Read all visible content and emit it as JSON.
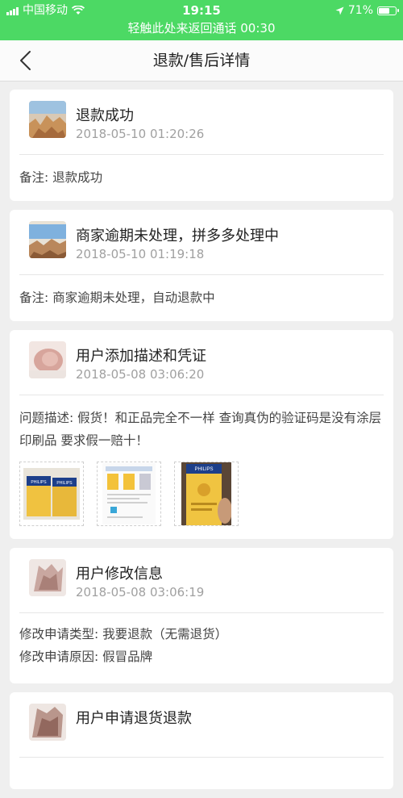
{
  "status_bar": {
    "carrier": "中国移动",
    "time": "19:15",
    "battery": "71%",
    "battery_level": 0.71,
    "call_banner": "轻触此处来返回通话 00:30"
  },
  "nav": {
    "title": "退款/售后详情",
    "back_icon": "chevron-left-icon"
  },
  "entries": [
    {
      "title": "退款成功",
      "time": "2018-05-10 01:20:26",
      "lines": [
        "备注: 退款成功"
      ]
    },
    {
      "title": "商家逾期未处理，拼多多处理中",
      "time": "2018-05-10 01:19:18",
      "lines": [
        "备注: 商家逾期未处理，自动退款中"
      ]
    },
    {
      "title": "用户添加描述和凭证",
      "time": "2018-05-08 03:06:20",
      "lines": [
        "问题描述: 假货！和正品完全不一样 查询真伪的验证码是没有涂层 印刷品 要求假一赔十！"
      ],
      "images": [
        "PHILIPS",
        "",
        "PHILIPS"
      ]
    },
    {
      "title": "用户修改信息",
      "time": "2018-05-08 03:06:19",
      "lines": [
        "修改申请类型: 我要退款（无需退货）",
        "修改申请原因: 假冒品牌"
      ]
    },
    {
      "title": "用户申请退货退款",
      "time": "",
      "lines": []
    }
  ],
  "colors": {
    "status_green": "#4cd964",
    "background": "#efefef",
    "card": "#ffffff",
    "timestamp": "#a0a0a0"
  }
}
